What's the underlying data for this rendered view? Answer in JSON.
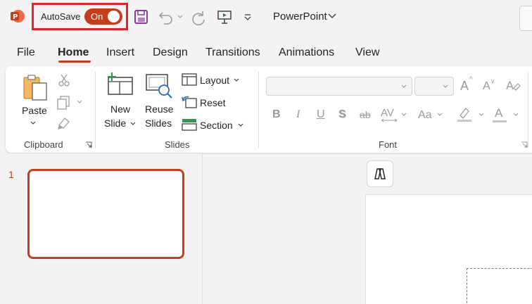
{
  "titlebar": {
    "autosave_label": "AutoSave",
    "autosave_state": "On",
    "app_name": "PowerPoint"
  },
  "tabs": [
    {
      "label": "File"
    },
    {
      "label": "Home",
      "active": true
    },
    {
      "label": "Insert"
    },
    {
      "label": "Design"
    },
    {
      "label": "Transitions"
    },
    {
      "label": "Animations"
    },
    {
      "label": "View"
    }
  ],
  "ribbon": {
    "clipboard": {
      "paste_label": "Paste",
      "group_label": "Clipboard"
    },
    "slides": {
      "new_slide_line1": "New",
      "new_slide_line2": "Slide",
      "reuse_line1": "Reuse",
      "reuse_line2": "Slides",
      "layout_label": "Layout",
      "reset_label": "Reset",
      "section_label": "Section",
      "group_label": "Slides"
    },
    "font": {
      "font_name_value": "",
      "font_size_value": "",
      "group_label": "Font",
      "bold": "B",
      "italic": "I",
      "underline": "U",
      "shadow": "S",
      "strike": "ab",
      "spacing": "AV",
      "case": "Aa",
      "grow": "A",
      "shrink": "A",
      "color_a": "A"
    }
  },
  "slides_pane": {
    "slide_number": "1"
  },
  "colors": {
    "accent": "#c43e1c",
    "highlight_box": "#e3222b"
  }
}
